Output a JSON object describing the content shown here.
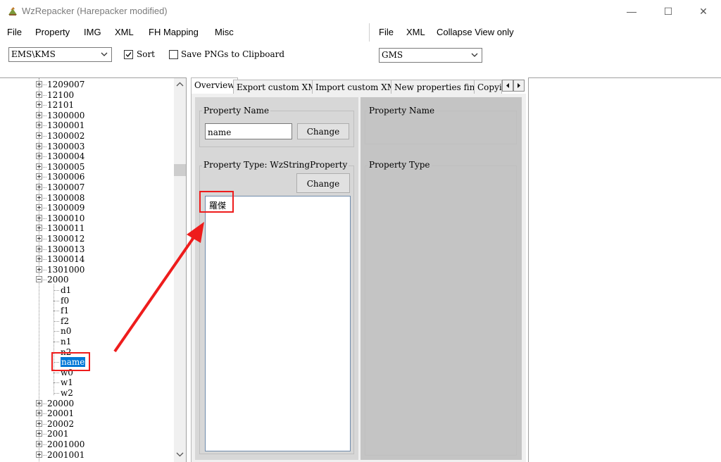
{
  "window": {
    "title": "WzRepacker (Harepacker modified)",
    "controls": {
      "minimize": "—",
      "maximize": "☐",
      "close": "✕"
    }
  },
  "menu_left": [
    "File",
    "Property",
    "IMG",
    "XML",
    "FH Mapping",
    "Misc"
  ],
  "menu_right": [
    "File",
    "XML",
    "Collapse View only"
  ],
  "toolbar": {
    "region_select": "EMS\\KMS",
    "sort_label": "Sort",
    "sort_checked": true,
    "save_png_label": "Save PNGs to Clipboard",
    "save_png_checked": false,
    "right_select": "GMS"
  },
  "tree": {
    "top_nodes": [
      "1209007",
      "12100",
      "12101",
      "1300000",
      "1300001",
      "1300002",
      "1300003",
      "1300004",
      "1300005",
      "1300006",
      "1300007",
      "1300008",
      "1300009",
      "1300010",
      "1300011",
      "1300012",
      "1300013",
      "1300014",
      "1301000"
    ],
    "expanded_node": "2000",
    "children": [
      "d1",
      "f0",
      "f1",
      "f2",
      "n0",
      "n1",
      "n2",
      "name",
      "w0",
      "w1",
      "w2"
    ],
    "selected_child": "name",
    "bottom_nodes": [
      "20000",
      "20001",
      "20002",
      "2001",
      "2001000",
      "2001001"
    ]
  },
  "tabs": [
    "Overview",
    "Export custom XML",
    "Import custom XML",
    "New properties finder",
    "Copyi"
  ],
  "overview": {
    "left": {
      "prop_name_label": "Property Name",
      "prop_name_value": "name",
      "change_label": "Change",
      "prop_type_label": "Property Type: WzStringProperty",
      "change2_label": "Change",
      "string_value": "羅傑"
    },
    "right": {
      "prop_name_label": "Property Name",
      "prop_type_label": "Property Type"
    }
  },
  "colors": {
    "selection": "#0078d7",
    "annotation": "#ee1c1c",
    "panel_left": "#d7d7d7",
    "panel_right": "#c4c4c4"
  }
}
